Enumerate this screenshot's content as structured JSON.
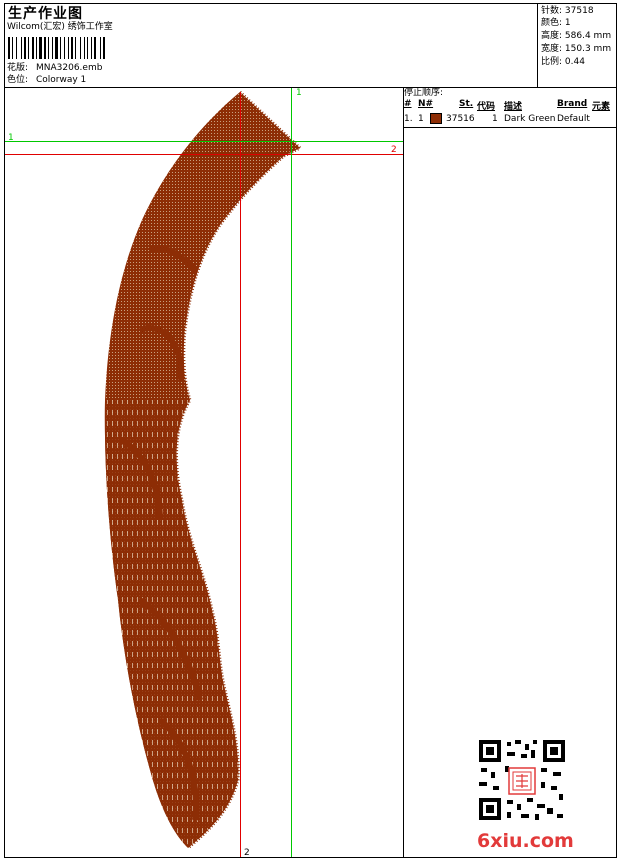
{
  "header": {
    "title": "生产作业图",
    "studio": "Wilcom(汇宏) 绣饰工作室",
    "design_label": "花版:",
    "design_file": "MNA3206.emb",
    "colorway_label": "色位:",
    "colorway": "Colorway 1"
  },
  "info": {
    "stitches_label": "针数:",
    "stitches": "37518",
    "colors_label": "颜色:",
    "colors": "1",
    "height_label": "高度:",
    "height": "586.4 mm",
    "width_label": "宽度:",
    "width": "150.3 mm",
    "scale_label": "比例:",
    "scale": "0.44"
  },
  "stop_sequence": {
    "title": "停止顺序:",
    "columns": [
      "#",
      "N#",
      "St.",
      "代码",
      "描述",
      "Brand",
      "元素"
    ],
    "rows": [
      {
        "index": "1.",
        "needle": "1",
        "stitches": "37516",
        "code": "1",
        "description": "Dark Green",
        "brand": "Default",
        "color": "#8d2d05"
      }
    ]
  },
  "guides": {
    "red_h_label": "2",
    "red_v_label": "2",
    "green_h_label": "1",
    "green_v_label": "1"
  },
  "colors": {
    "thread": "#8d2d05",
    "guide_red": "#e00000",
    "guide_green": "#00c800"
  },
  "watermark": {
    "text": "6xiu.com",
    "icon": "qr-code-icon"
  }
}
